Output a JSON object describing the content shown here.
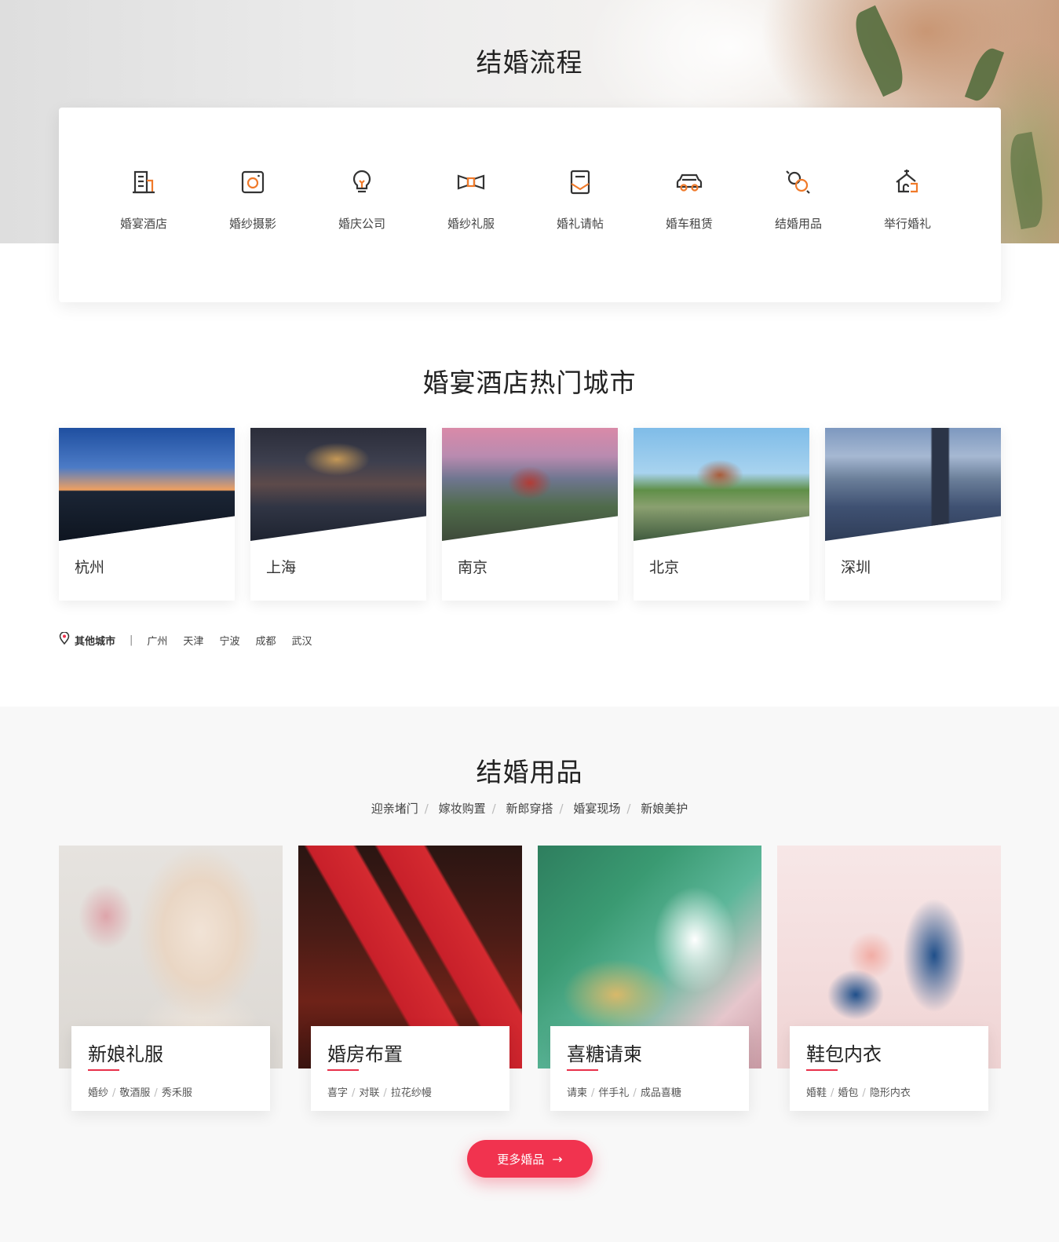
{
  "process": {
    "title": "结婚流程",
    "items": [
      {
        "label": "婚宴酒店",
        "icon": "hotel-icon"
      },
      {
        "label": "婚纱摄影",
        "icon": "camera-icon"
      },
      {
        "label": "婚庆公司",
        "icon": "lightbulb-icon"
      },
      {
        "label": "婚纱礼服",
        "icon": "bowtie-icon"
      },
      {
        "label": "婚礼请帖",
        "icon": "invitation-icon"
      },
      {
        "label": "婚车租赁",
        "icon": "car-icon"
      },
      {
        "label": "结婚用品",
        "icon": "candy-icon"
      },
      {
        "label": "举行婚礼",
        "icon": "chapel-icon"
      }
    ]
  },
  "cities": {
    "title": "婚宴酒店热门城市",
    "items": [
      {
        "name": "杭州"
      },
      {
        "name": "上海"
      },
      {
        "name": "南京"
      },
      {
        "name": "北京"
      },
      {
        "name": "深圳"
      }
    ],
    "other_label": "其他城市",
    "separator": "|",
    "others": [
      "广州",
      "天津",
      "宁波",
      "成都",
      "武汉"
    ]
  },
  "supplies": {
    "title": "结婚用品",
    "tabs": [
      "迎亲堵门",
      "嫁妆购置",
      "新郎穿搭",
      "婚宴现场",
      "新娘美护"
    ],
    "tab_separator": "/",
    "products": [
      {
        "title": "新娘礼服",
        "tags": [
          "婚纱",
          "敬酒服",
          "秀禾服"
        ]
      },
      {
        "title": "婚房布置",
        "tags": [
          "喜字",
          "对联",
          "拉花纱幔"
        ]
      },
      {
        "title": "喜糖请柬",
        "tags": [
          "请柬",
          "伴手礼",
          "成品喜糖"
        ]
      },
      {
        "title": "鞋包内衣",
        "tags": [
          "婚鞋",
          "婚包",
          "隐形内衣"
        ]
      }
    ],
    "more_button": "更多婚品",
    "more_arrow": "→"
  },
  "colors": {
    "accent": "#f1334f",
    "icon_orange": "#f07a2a",
    "icon_dark": "#333333"
  }
}
